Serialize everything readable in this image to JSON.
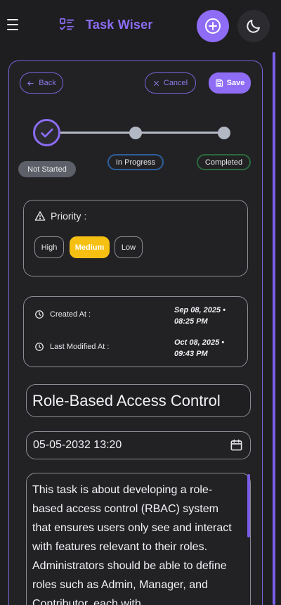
{
  "header": {
    "app_title": "Task Wiser",
    "icons": {
      "menu": "hamburger-menu-icon",
      "logo": "task-list-icon",
      "add": "plus-circle-icon",
      "theme": "moon-icon"
    }
  },
  "toolbar": {
    "back_label": "Back",
    "cancel_label": "Cancel",
    "save_label": "Save"
  },
  "status": {
    "steps": [
      "Not Started",
      "In Progress",
      "Completed"
    ],
    "current": "Not Started",
    "colors": {
      "active": "#8b6cf2",
      "in_progress": "#2d5f9c",
      "completed": "#2b6a3c"
    }
  },
  "priority": {
    "label": "Priority :",
    "options": [
      "High",
      "Medium",
      "Low"
    ],
    "selected": "Medium",
    "selected_color": "#f6c012"
  },
  "dates": {
    "created_label": "Created At :",
    "created_value": "Sep 08, 2025 • 08:25 PM",
    "modified_label": "Last Modified At :",
    "modified_value": "Oct 08, 2025 • 09:43 PM"
  },
  "task": {
    "title": "Role-Based Access Control",
    "due": "05-05-2032 13:20",
    "description": "This task is about developing a role-based access control (RBAC) system that ensures users only see and interact with features relevant to their roles. Administrators should be able to define roles such as Admin, Manager, and Contributor, each with"
  }
}
